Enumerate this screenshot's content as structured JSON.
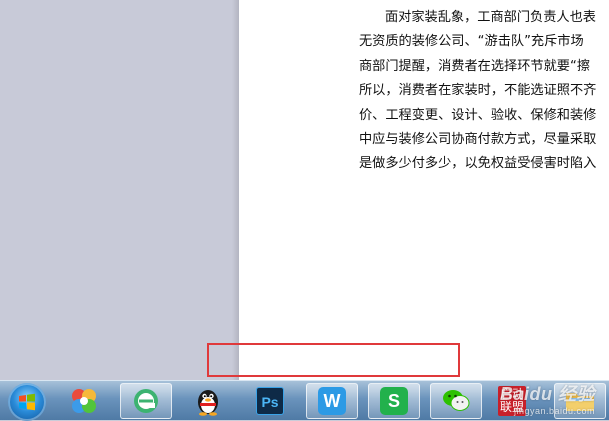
{
  "document": {
    "paragraph_lines": [
      "面对家装乱象，工商部门负责人也表",
      "无资质的装修公司、“游击队”充斥市场",
      "商部门提醒，消费者在选择环节就要“擦",
      "所以，消费者在家装时，不能选证照不齐",
      "价、工程变更、设计、验收、保修和装修",
      "中应与装修公司协商付款方式，尽量采取",
      "是做多少付多少，以免权益受侵害时陷入"
    ]
  },
  "highlight": {
    "color": "#e0393b"
  },
  "taskbar": {
    "start_button": {
      "icon": "windows-flag-icon"
    },
    "apps": [
      {
        "icon": "pinwheel-app-icon",
        "active": false
      },
      {
        "icon": "browser-e-icon",
        "active": true
      },
      {
        "icon": "qq-penguin-icon",
        "active": false
      },
      {
        "icon": "photoshop-icon",
        "label": "Ps",
        "active": false
      },
      {
        "icon": "wps-writer-icon",
        "label": "W",
        "active": true
      },
      {
        "icon": "wps-spreadsheet-icon",
        "label": "S",
        "active": true
      },
      {
        "icon": "wechat-icon",
        "active": true
      },
      {
        "icon": "seal-app-icon",
        "label": "启动\n联盟",
        "active": false
      },
      {
        "icon": "file-explorer-icon",
        "active": true
      }
    ]
  },
  "watermark": {
    "text": "Baidu 经验",
    "sub": "jingyan.baidu.com"
  }
}
